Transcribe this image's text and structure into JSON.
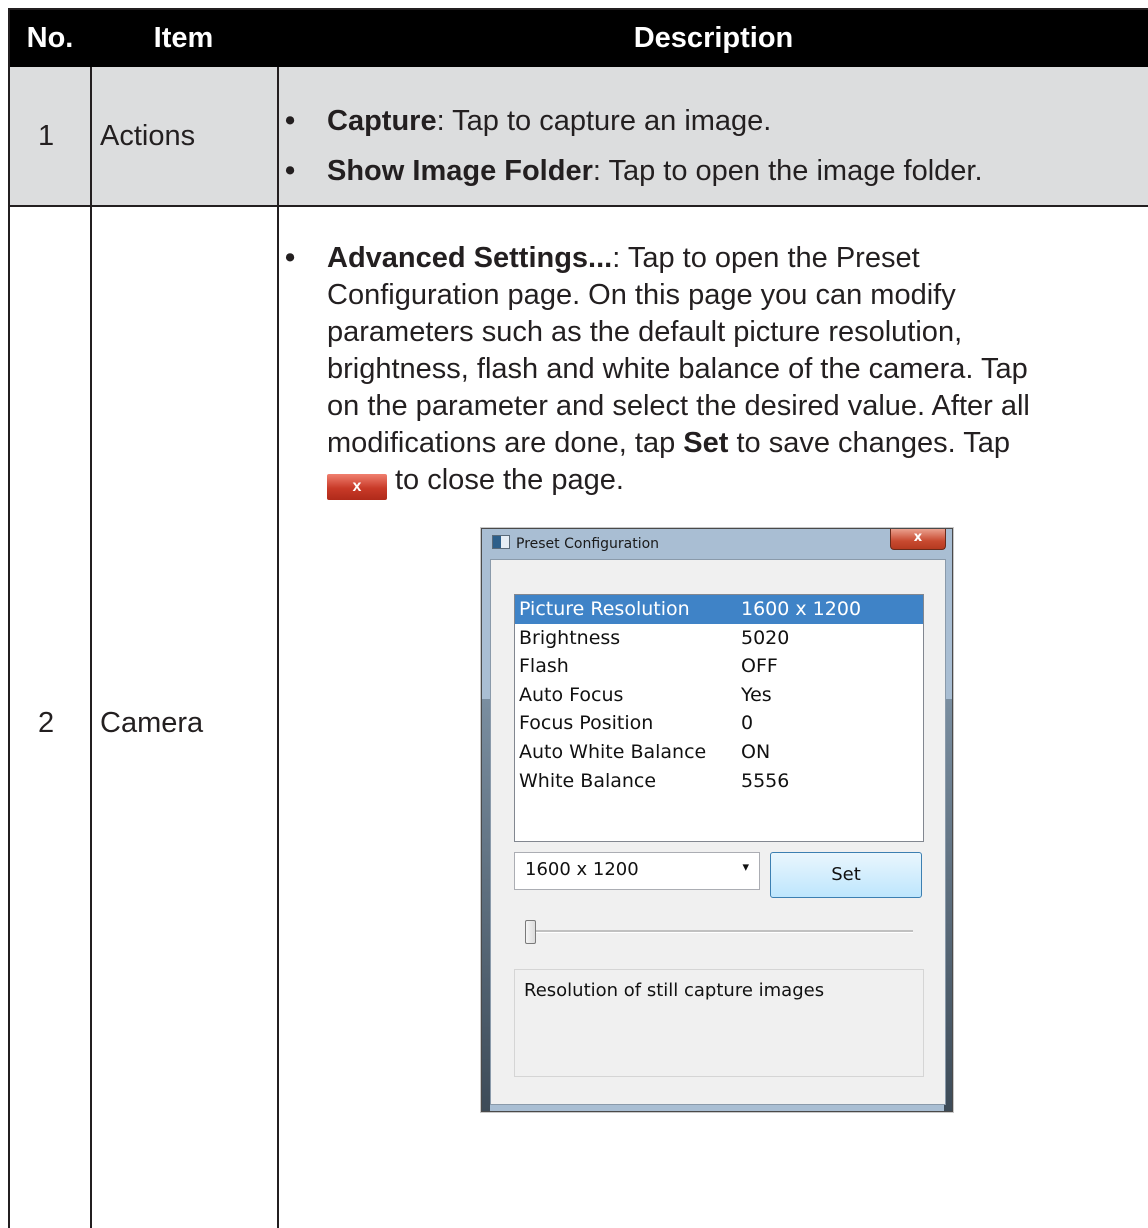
{
  "table": {
    "headers": {
      "no": "No.",
      "item": "Item",
      "description": "Description"
    },
    "rows": [
      {
        "no": "1",
        "item": "Actions",
        "bullets": [
          {
            "term": "Capture",
            "text": ": Tap to capture an image."
          },
          {
            "term": "Show Image Folder",
            "text": ": Tap to open the image folder."
          }
        ]
      },
      {
        "no": "2",
        "item": "Camera",
        "bullet_term": "Advanced Settings...",
        "line1": ": Tap to open the Preset",
        "line2": "Configuration page. On this page you can modify",
        "line3": "parameters such as the default picture resolution,",
        "line4": "brightness, flash and white balance of the camera. Tap",
        "line5": "on the parameter and select the desired value. After all",
        "line6a": "modifications are done, tap ",
        "line6b": "Set",
        "line6c": " to save changes. Tap",
        "line7": "to close the page.",
        "close_glyph": "x"
      }
    ]
  },
  "dialog": {
    "title": "Preset Configuration",
    "close_glyph": "x",
    "params": [
      {
        "name": "Picture Resolution",
        "value": "1600 x 1200",
        "selected": true
      },
      {
        "name": "Brightness",
        "value": "5020"
      },
      {
        "name": "Flash",
        "value": "OFF"
      },
      {
        "name": "Auto Focus",
        "value": "Yes"
      },
      {
        "name": "Focus Position",
        "value": "0"
      },
      {
        "name": "Auto White Balance",
        "value": "ON"
      },
      {
        "name": "White Balance",
        "value": "5556"
      }
    ],
    "select_value": "1600 x 1200",
    "select_arrow": "▾",
    "set_label": "Set",
    "slider_value": 0,
    "description": "Resolution of still capture images"
  },
  "colors": {
    "header_bg": "#000000",
    "row_shade": "#dcddde",
    "selection": "#3f83c7"
  }
}
